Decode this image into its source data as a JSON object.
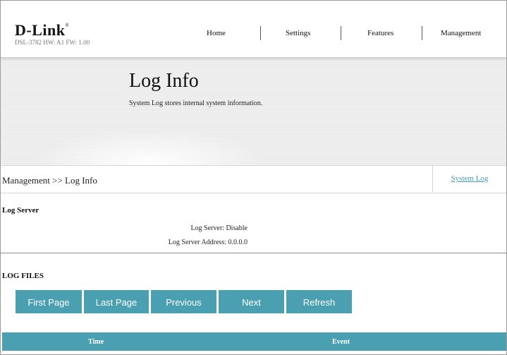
{
  "brand": {
    "logo": "D-Link",
    "trademark": "®",
    "model_info": "DSL-3782  HW: A1  FW: 1.00"
  },
  "nav": {
    "items": [
      "Home",
      "Settings",
      "Features",
      "Management"
    ]
  },
  "banner": {
    "title": "Log Info",
    "description": "System Log stores internal system information."
  },
  "breadcrumb": {
    "text": "Management >> Log Info"
  },
  "tabs": {
    "system_log": "System Log"
  },
  "log_server": {
    "title": "Log Server",
    "status_label": "Log Server:",
    "status_value": "Disable",
    "address_label": "Log Server Address:",
    "address_value": "0.0.0.0"
  },
  "log_files": {
    "title": "LOG FILES",
    "buttons": [
      "First Page",
      "Last Page",
      "Previous",
      "Next",
      "Refresh"
    ],
    "columns": [
      "Time",
      "Event"
    ]
  },
  "colors": {
    "accent": "#4a9fb1",
    "link": "#4a98b5"
  }
}
